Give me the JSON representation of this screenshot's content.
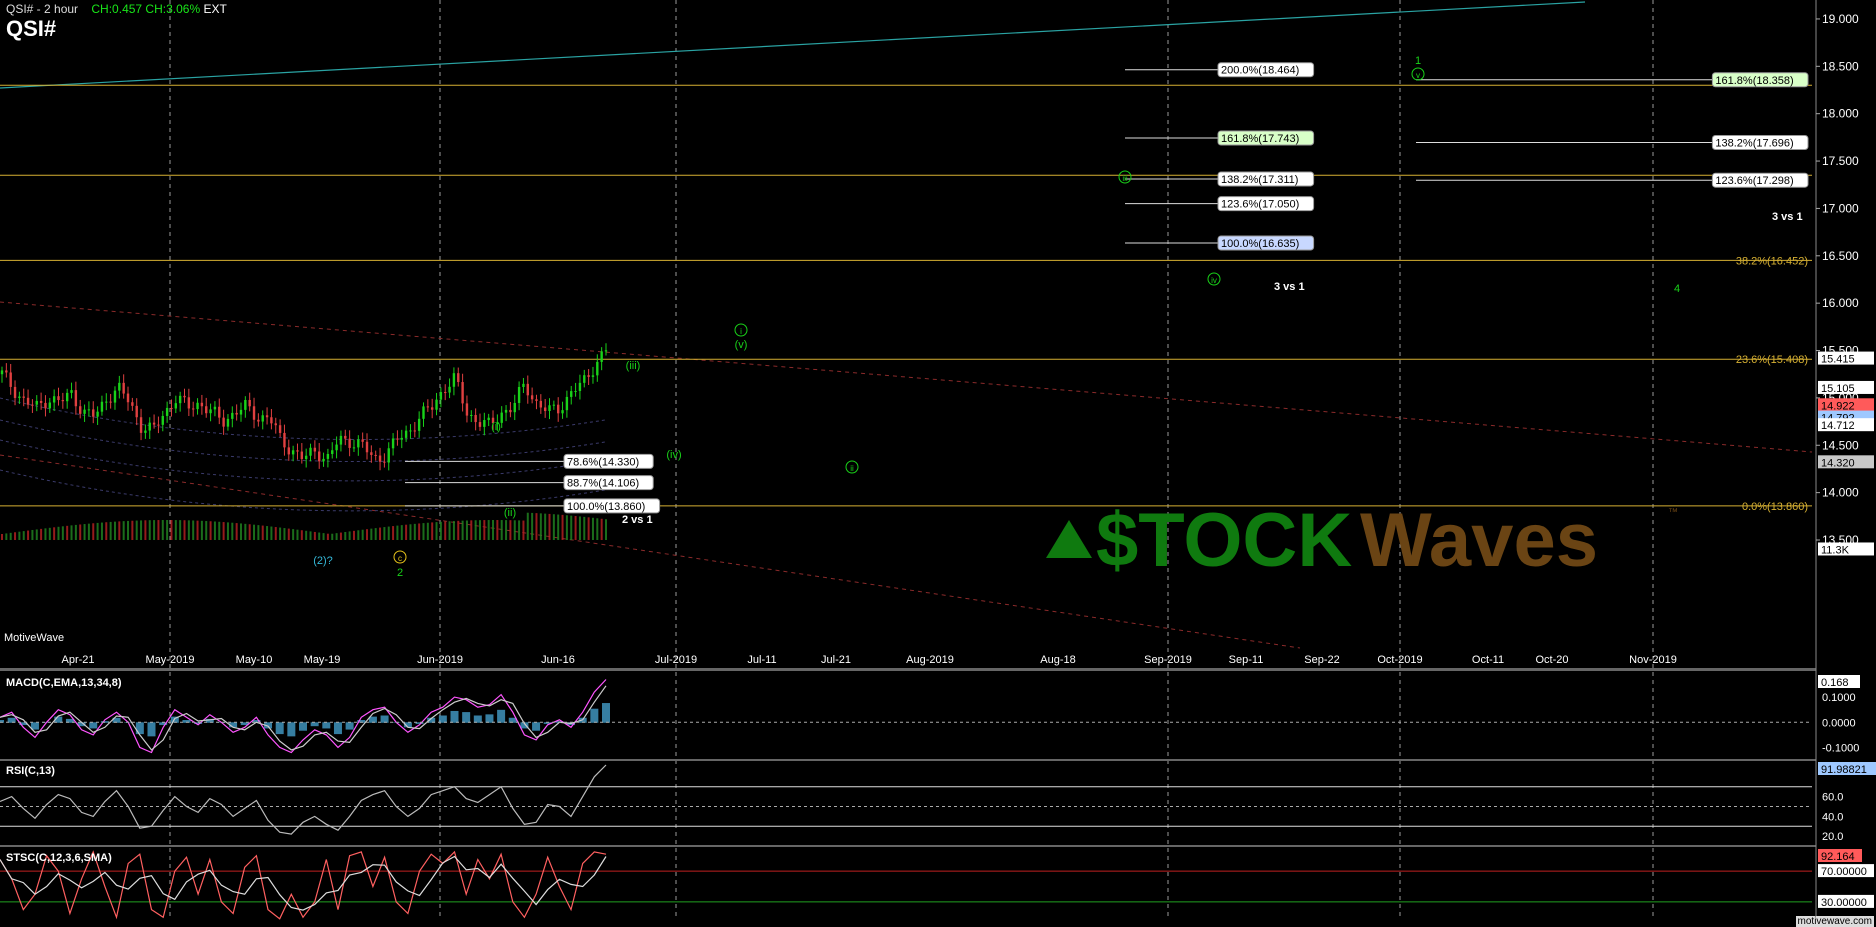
{
  "header": {
    "title": "QSI# - 2 hour",
    "change": "CH:0.457 CH:3.06%",
    "session": "EXT",
    "symbol": "QSI#"
  },
  "watermark": {
    "brand_left": "$TOCK",
    "brand_right": "Waves",
    "tm": "™"
  },
  "footer": {
    "brand": "MotiveWave",
    "site": "motivewave.com"
  },
  "colors": {
    "background": "#000000",
    "fib_line": "#d6b033",
    "grid": "#9a9a9a",
    "wave_green": "#19d219",
    "wave_cyan": "#35b8d8",
    "wave_yellow": "#e6c21a",
    "macd_line": "#ff55ff",
    "hist": "#4db3e6",
    "watermark_green": "#0f7a0f",
    "watermark_brown": "#6a4414"
  },
  "chart_data": [
    {
      "type": "candlestick",
      "title": "QSI# - 2 hour",
      "x_ticks": [
        "Apr-21",
        "May-2019",
        "May-10",
        "May-19",
        "Jun-2019",
        "Jun-16",
        "Jul-2019",
        "Jul-11",
        "Jul-21",
        "Aug-2019",
        "Aug-18",
        "Sep-2019",
        "Sep-11",
        "Sep-22",
        "Oct-2019",
        "Oct-11",
        "Oct-20",
        "Nov-2019"
      ],
      "y_ticks": [
        13.5,
        14.0,
        14.5,
        15.0,
        15.5,
        16.0,
        16.5,
        17.0,
        17.5,
        18.0,
        18.5,
        19.0
      ],
      "ylim": [
        13.5,
        19.2
      ],
      "price_path": [
        15.25,
        15.1,
        14.95,
        14.9,
        15.0,
        14.95,
        15.05,
        14.85,
        14.8,
        15.0,
        15.1,
        14.95,
        14.7,
        14.65,
        14.85,
        15.0,
        14.9,
        14.95,
        14.85,
        14.75,
        14.85,
        14.9,
        14.8,
        14.8,
        14.55,
        14.45,
        14.35,
        14.45,
        14.35,
        14.55,
        14.55,
        14.5,
        14.35,
        14.4,
        14.55,
        14.65,
        14.8,
        14.9,
        15.1,
        15.2,
        14.85,
        14.75,
        14.7,
        14.85,
        14.9,
        15.15,
        14.95,
        14.85,
        14.9,
        15.05,
        15.15,
        15.35,
        15.5
      ],
      "right_labels": [
        {
          "value": "15.415",
          "bg": "#ffffff",
          "fg": "#000000",
          "price": 15.415
        },
        {
          "value": "15.105",
          "bg": "#ffffff",
          "fg": "#000000",
          "price": 15.105
        },
        {
          "value": "14.922",
          "bg": "#ff5a5a",
          "fg": "#000000",
          "price": 14.922
        },
        {
          "value": "14.792",
          "bg": "#9ec8ff",
          "fg": "#000000",
          "price": 14.792
        },
        {
          "value": "14.712",
          "bg": "#ffffff",
          "fg": "#000000",
          "price": 14.712
        },
        {
          "value": "14.320",
          "bg": "#c8c8c8",
          "fg": "#000000",
          "price": 14.32
        },
        {
          "value": "11.3K",
          "bg": "#ffffff",
          "fg": "#000000",
          "price": 13.4
        }
      ],
      "fib_levels_right": [
        {
          "label": "38.2%(16.452)",
          "price": 16.452
        },
        {
          "label": "23.6%(15.408)",
          "price": 15.408
        },
        {
          "label": "0.0%(13.860)",
          "price": 13.86
        }
      ],
      "fib_boxes_mid": [
        {
          "label": "200.0%(18.464)",
          "price": 18.464,
          "bg": "#ffffff"
        },
        {
          "label": "161.8%(17.743)",
          "price": 17.743,
          "bg": "#d8ffc8"
        },
        {
          "label": "138.2%(17.311)",
          "price": 17.311,
          "bg": "#ffffff"
        },
        {
          "label": "123.6%(17.050)",
          "price": 17.05,
          "bg": "#ffffff"
        },
        {
          "label": "100.0%(16.635)",
          "price": 16.635,
          "bg": "#c8d8ff"
        }
      ],
      "fib_boxes_right": [
        {
          "label": "161.8%(18.358)",
          "price": 18.358,
          "bg": "#d8ffc8"
        },
        {
          "label": "138.2%(17.696)",
          "price": 17.696,
          "bg": "#ffffff"
        },
        {
          "label": "123.6%(17.298)",
          "price": 17.298,
          "bg": "#ffffff"
        }
      ],
      "fib_boxes_left": [
        {
          "label": "78.6%(14.330)",
          "price": 14.33,
          "bg": "#ffffff"
        },
        {
          "label": "88.7%(14.106)",
          "price": 14.106,
          "bg": "#ffffff"
        },
        {
          "label": "100.0%(13.860)",
          "price": 13.86,
          "bg": "#ffffff"
        }
      ],
      "text_labels": [
        "2 vs 1",
        "3 vs 1",
        "3 vs 1"
      ],
      "wave_labels": [
        "(i)",
        "(ii)",
        "(iii)",
        "(iv)",
        "(v)",
        "i",
        "ii",
        "iii",
        "iv",
        "v",
        "1",
        "2",
        "3",
        "4",
        "c",
        "(2)?"
      ]
    },
    {
      "type": "line",
      "title": "MACD(C,EMA,13,34,8)",
      "y_ticks": [
        "0.1000",
        "0.0000",
        "-0.1000"
      ],
      "ylim": [
        -0.15,
        0.2
      ],
      "last_value": "0.168",
      "values": [
        0.02,
        0.04,
        -0.02,
        -0.06,
        0.0,
        0.05,
        0.03,
        -0.03,
        -0.05,
        0.01,
        0.04,
        0.0,
        -0.1,
        -0.12,
        -0.02,
        0.05,
        0.02,
        -0.01,
        0.03,
        0.0,
        -0.04,
        -0.02,
        0.02,
        -0.05,
        -0.1,
        -0.12,
        -0.07,
        -0.03,
        -0.05,
        -0.1,
        -0.06,
        0.02,
        0.05,
        0.06,
        0.0,
        -0.04,
        -0.01,
        0.04,
        0.06,
        0.1,
        0.09,
        0.06,
        0.07,
        0.11,
        0.04,
        -0.05,
        -0.07,
        -0.01,
        0.01,
        -0.02,
        0.04,
        0.12,
        0.17
      ]
    },
    {
      "type": "line",
      "title": "RSI(C,13)",
      "y_ticks": [
        "60.0",
        "40.0",
        "20.0"
      ],
      "ylim": [
        10,
        95
      ],
      "last_value": "91.98821",
      "values": [
        55,
        60,
        48,
        38,
        52,
        62,
        58,
        44,
        40,
        55,
        66,
        50,
        28,
        30,
        46,
        60,
        50,
        44,
        58,
        52,
        40,
        48,
        56,
        36,
        24,
        22,
        34,
        40,
        32,
        26,
        40,
        56,
        62,
        66,
        50,
        40,
        48,
        62,
        66,
        70,
        58,
        54,
        62,
        70,
        48,
        32,
        34,
        52,
        50,
        40,
        60,
        80,
        92
      ]
    },
    {
      "type": "line",
      "title": "STSC(C,12,3,6,SMA)",
      "y_ticks": [
        "70.00000",
        "30.00000"
      ],
      "ylim": [
        0,
        100
      ],
      "last_value": "92.164",
      "values": [
        85,
        60,
        20,
        40,
        90,
        70,
        15,
        60,
        95,
        50,
        10,
        80,
        92,
        20,
        10,
        70,
        88,
        40,
        85,
        30,
        15,
        75,
        90,
        20,
        8,
        40,
        10,
        30,
        85,
        20,
        90,
        95,
        50,
        88,
        30,
        15,
        70,
        92,
        80,
        95,
        40,
        85,
        60,
        92,
        30,
        10,
        40,
        88,
        50,
        20,
        80,
        95,
        92
      ]
    }
  ]
}
